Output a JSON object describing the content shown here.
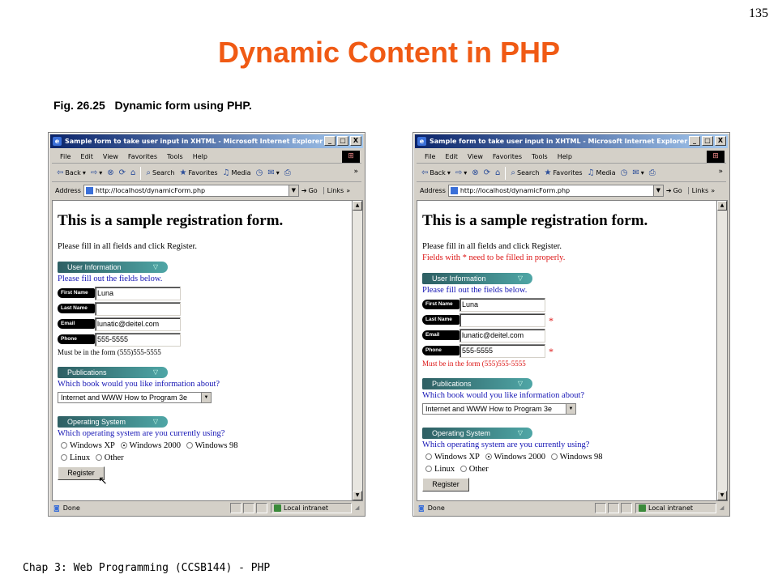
{
  "slide": {
    "page_number": "135",
    "title": "Dynamic Content in PHP",
    "caption": "Fig. 26.25   Dynamic form using PHP.",
    "footer": "Chap 3: Web Programming (CCSB144) - PHP"
  },
  "browser": {
    "title": "Sample form to take user input in XHTML - Microsoft Internet Explorer",
    "controls": {
      "minimize": "_",
      "maximize": "□",
      "close": "X"
    },
    "menu": [
      "File",
      "Edit",
      "View",
      "Favorites",
      "Tools",
      "Help"
    ],
    "toolbar": {
      "back": "Back",
      "search": "Search",
      "favorites": "Favorites",
      "media": "Media",
      "more": "»"
    },
    "address_label": "Address",
    "address_value": "http://localhost/dynamicForm.php",
    "go_label": "Go",
    "links_label": "Links",
    "status_text": "Done",
    "zone_text": "Local intranet"
  },
  "form": {
    "heading": "This is a sample registration form.",
    "instructions": "Please fill in all fields and click Register.",
    "error_message": "Fields with * need to be filled in properly.",
    "section_user": "User Information",
    "fill_prompt": "Please fill out the fields below.",
    "label_first": "First Name",
    "label_last": "Last Name",
    "label_email": "Email",
    "label_phone": "Phone",
    "value_first": "Luna",
    "value_last": "",
    "value_email": "lunatic@deitel.com",
    "value_phone": "555-5555",
    "phone_format": "Must be in the form (555)555-5555",
    "star": "*",
    "section_publications": "Publications",
    "book_question": "Which book would you like information about?",
    "book_selected": "Internet and WWW How to Program 3e",
    "section_os": "Operating System",
    "os_question": "Which operating system are you currently using?",
    "os_options_row1": [
      "Windows XP",
      "Windows 2000",
      "Windows 98"
    ],
    "os_options_row2": [
      "Linux",
      "Other"
    ],
    "os_selected": "Windows 2000",
    "register_label": "Register"
  },
  "colors": {
    "title": "#f05a14",
    "link_blue": "#1414b4",
    "error_red": "#dc1414",
    "titlebar_start": "#0a246a",
    "titlebar_end": "#a6caf0"
  }
}
